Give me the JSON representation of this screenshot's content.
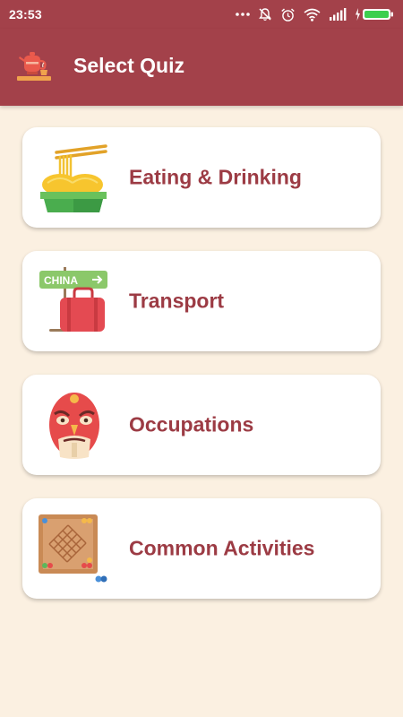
{
  "status_bar": {
    "time": "23:53",
    "icons": [
      "more-dots-icon",
      "notifications-off-icon",
      "alarm-icon",
      "wifi-icon",
      "signal-icon",
      "battery-charging-icon"
    ]
  },
  "app_bar": {
    "title": "Select Quiz",
    "logo_icon": "teapot-icon"
  },
  "quizzes": [
    {
      "label": "Eating & Drinking",
      "icon": "noodle-bowl-icon"
    },
    {
      "label": "Transport",
      "icon": "luggage-sign-icon",
      "sign_text": "CHINA"
    },
    {
      "label": "Occupations",
      "icon": "opera-mask-icon"
    },
    {
      "label": "Common Activities",
      "icon": "board-game-icon"
    }
  ],
  "colors": {
    "primary": "#a3414a",
    "background": "#fbf0e1",
    "card": "#ffffff",
    "label": "#9c3b44"
  }
}
